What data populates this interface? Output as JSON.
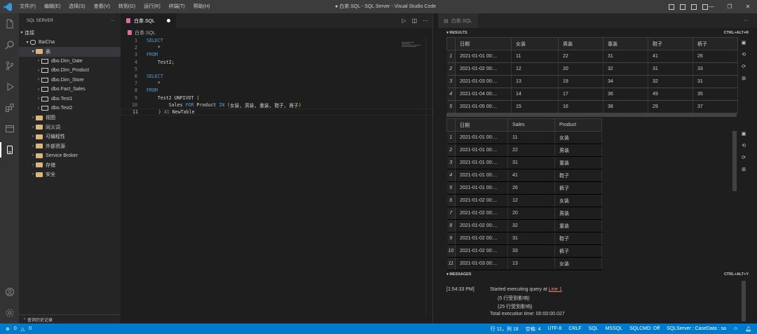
{
  "titlebar": {
    "menu": [
      "文件(F)",
      "编辑(E)",
      "选择(S)",
      "查看(V)",
      "转到(G)",
      "运行(R)",
      "终端(T)",
      "帮助(H)"
    ],
    "title": "● 白茶.SQL - SQL Server - Visual Studio Code",
    "controls": [
      "—",
      "❐",
      "✕"
    ]
  },
  "activity": [
    "explorer-icon",
    "search-icon",
    "source-control-icon",
    "run-icon",
    "extensions-icon",
    "remote-icon",
    "sql-server-icon"
  ],
  "sidebar": {
    "header": "SQL SERVER",
    "more": "···",
    "connections_label": "连接",
    "server": "BaiCha",
    "tables_folder": "表",
    "tables": [
      "dbo.Dim_Date",
      "dbo.Dim_Product",
      "dbo.Dim_Store",
      "dbo.Fact_Sales",
      "dbo.Test1",
      "dbo.Test2"
    ],
    "folders": [
      "视图",
      "同义词",
      "可编程性",
      "外部资源",
      "Service Broker",
      "存储",
      "安全"
    ],
    "footer": "查询历史记录"
  },
  "editor": {
    "tab_label": "白茶.SQL",
    "breadcrumb": "白茶.SQL",
    "lines": [
      {
        "n": "1",
        "tokens": [
          {
            "t": "SELECT",
            "c": "kw"
          }
        ]
      },
      {
        "n": "2",
        "tokens": [
          {
            "t": "    *",
            "c": "id"
          }
        ]
      },
      {
        "n": "3",
        "tokens": [
          {
            "t": "FROM",
            "c": "kw"
          }
        ]
      },
      {
        "n": "4",
        "tokens": [
          {
            "t": "    Test2;",
            "c": "id"
          }
        ]
      },
      {
        "n": "5",
        "tokens": []
      },
      {
        "n": "6",
        "tokens": [
          {
            "t": "SELECT",
            "c": "kw"
          }
        ]
      },
      {
        "n": "7",
        "tokens": [
          {
            "t": "    *",
            "c": "id"
          }
        ]
      },
      {
        "n": "8",
        "tokens": [
          {
            "t": "FROM",
            "c": "kw"
          }
        ]
      },
      {
        "n": "9",
        "tokens": [
          {
            "t": "    Test2 UNPIVOT ",
            "c": "id"
          },
          {
            "t": "(",
            "c": "pun"
          }
        ]
      },
      {
        "n": "10",
        "tokens": [
          {
            "t": "        Sales ",
            "c": "id"
          },
          {
            "t": "FOR",
            "c": "kw"
          },
          {
            "t": " Product ",
            "c": "id"
          },
          {
            "t": "IN",
            "c": "kw"
          },
          {
            "t": " ",
            "c": "id"
          },
          {
            "t": "(",
            "c": "pun"
          },
          {
            "t": "女装, 男装, 童装, 鞋子, 裤子",
            "c": "id"
          },
          {
            "t": ")",
            "c": "pun"
          }
        ]
      },
      {
        "n": "11",
        "tokens": [
          {
            "t": "    ",
            "c": "id"
          },
          {
            "t": ")",
            "c": "pun"
          },
          {
            "t": " ",
            "c": "id"
          },
          {
            "t": "AS",
            "c": "kw"
          },
          {
            "t": " NewTable",
            "c": "id"
          }
        ]
      }
    ]
  },
  "results": {
    "tab_label": "白茶.SQL",
    "more": "···",
    "results_header": "RESULTS",
    "shortcut_results": "CTRL+ALT+R",
    "grid1": {
      "columns": [
        "日期",
        "女装",
        "男装",
        "童装",
        "鞋子",
        "裤子"
      ],
      "rows": [
        [
          "1",
          "2021-01-01 00:...",
          "11",
          "22",
          "31",
          "41",
          "26"
        ],
        [
          "2",
          "2021-01-02 00:...",
          "12",
          "20",
          "32",
          "31",
          "33"
        ],
        [
          "3",
          "2021-01-03 00:...",
          "13",
          "19",
          "34",
          "32",
          "31"
        ],
        [
          "4",
          "2021-01-04 00:...",
          "14",
          "17",
          "36",
          "49",
          "35"
        ],
        [
          "5",
          "2021-01-05 00:...",
          "15",
          "16",
          "38",
          "29",
          "37"
        ]
      ]
    },
    "grid2": {
      "columns": [
        "日期",
        "Sales",
        "Product"
      ],
      "rows": [
        [
          "1",
          "2021-01-01 00:...",
          "11",
          "女装"
        ],
        [
          "2",
          "2021-01-01 00:...",
          "22",
          "男装"
        ],
        [
          "3",
          "2021-01-01 00:...",
          "31",
          "童装"
        ],
        [
          "4",
          "2021-01-01 00:...",
          "41",
          "鞋子"
        ],
        [
          "5",
          "2021-01-01 00:...",
          "26",
          "裤子"
        ],
        [
          "6",
          "2021-01-02 00:...",
          "12",
          "女装"
        ],
        [
          "7",
          "2021-01-02 00:...",
          "20",
          "男装"
        ],
        [
          "8",
          "2021-01-02 00:...",
          "32",
          "童装"
        ],
        [
          "9",
          "2021-01-02 00:...",
          "31",
          "鞋子"
        ],
        [
          "10",
          "2021-01-02 00:...",
          "33",
          "裤子"
        ],
        [
          "11",
          "2021-01-03 00:...",
          "13",
          "女装"
        ]
      ]
    },
    "messages_header": "MESSAGES",
    "shortcut_messages": "CTRL+ALT+Y",
    "messages": {
      "time": "[1:54:33 PM]",
      "started": "Started executing query at ",
      "link": "Line 1",
      "r1": "(5 行受到影响)",
      "r2": "(25 行受到影响)",
      "exec": "Total execution time: 00:00:00.027"
    }
  },
  "statusbar": {
    "errors": "0",
    "warnings": "0",
    "position": "行 11，列 18",
    "spaces": "空格: 4",
    "encoding": "UTF-8",
    "eol": "CRLF",
    "language": "SQL",
    "dialect": "MSSQL",
    "sqlcmd": "SQLCMD: Off",
    "connection": "SQLServer : CaseData : sa"
  }
}
